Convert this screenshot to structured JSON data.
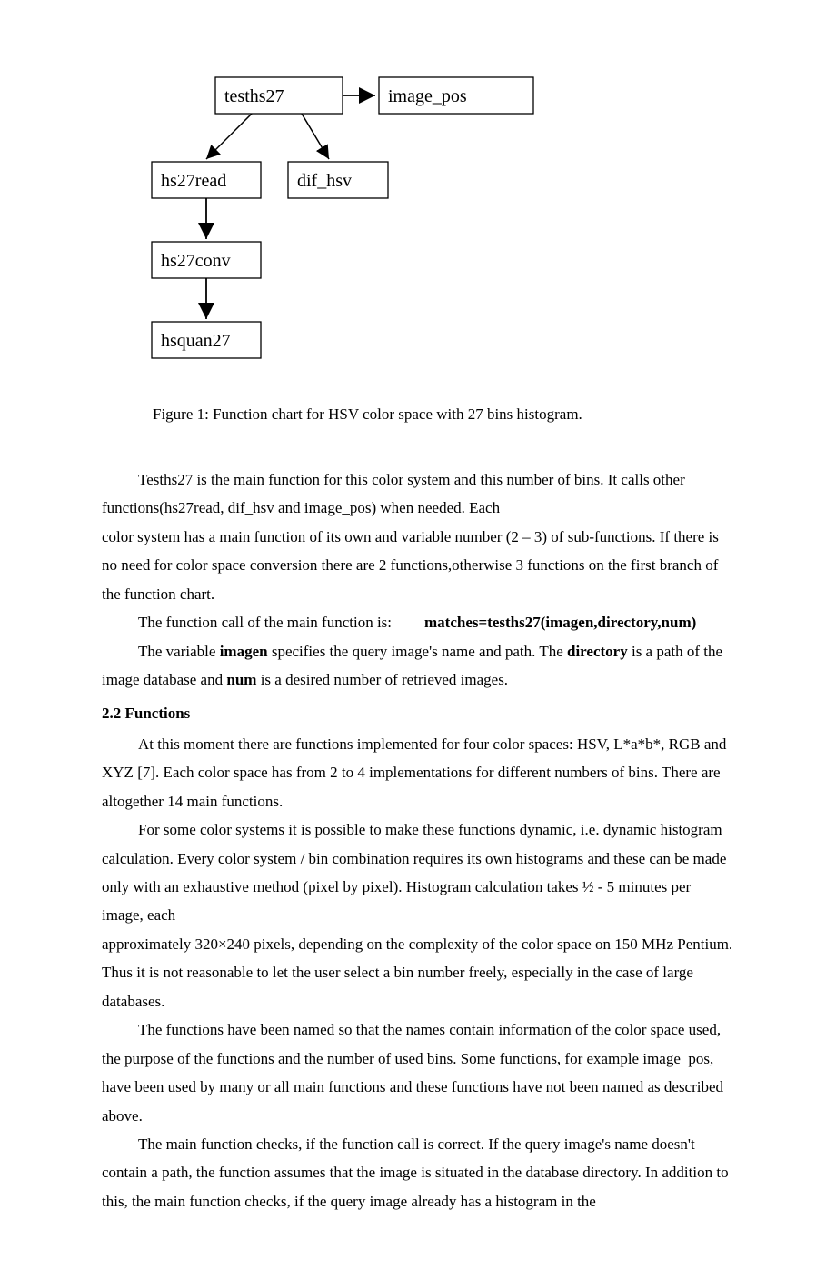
{
  "diagram": {
    "nodes": {
      "tesths27": "tesths27",
      "image_pos": "image_pos",
      "hs27read": "hs27read",
      "dif_hsv": "dif_hsv",
      "hs27conv": "hs27conv",
      "hsquan27": "hsquan27"
    }
  },
  "figure_caption": "Figure 1: Function chart for HSV color space with 27 bins histogram.",
  "para1_a": "Tesths27 is the main function for this color system and this number of bins. It calls other functions(hs27read, dif_hsv and image_pos) when needed. Each",
  "para1_b": "color system has a main function of its own and variable number (2 – 3) of sub-functions. If there is no need for color space conversion there are 2 functions,otherwise 3 functions on the first branch of the function chart.",
  "call_label": "The function call of the main function is:",
  "call_code": "matches=tesths27(imagen,directory,num)",
  "para3_a": "The variable ",
  "para3_b": "imagen",
  "para3_c": " specifies the query image's name and path. The ",
  "para3_d": "directory",
  "para3_e": " is a path of the image database and ",
  "para3_f": "num",
  "para3_g": " is a desired number of retrieved images.",
  "section22": "2.2 Functions",
  "para4": "At this moment there are functions implemented for four color spaces: HSV, L*a*b*, RGB and XYZ [7]. Each color space has from 2 to 4 implementations for different numbers of bins. There are altogether 14 main functions.",
  "para5_a": "For some color systems it is possible to make these functions dynamic, i.e. dynamic histogram calculation. Every color system / bin combination requires its own histograms and these can be made only with an exhaustive method (pixel by pixel). Histogram calculation takes ½ - 5 minutes per image, each",
  "para5_b": "approximately 320×240 pixels, depending on the complexity of the color space on 150 MHz Pentium. Thus it is not reasonable to let the user select a bin number freely, especially in the case of large databases.",
  "para6": "The functions have been named so that the names contain information of the color space used, the purpose of the functions and the number of used bins. Some functions, for example image_pos, have been used by many or all main functions and these functions have not been named as described above.",
  "para7": "The main function checks, if the function call is correct. If the query image's name doesn't contain a path, the function assumes that the image is situated in the database directory. In addition to this, the main function checks, if the query image already has a histogram in the"
}
